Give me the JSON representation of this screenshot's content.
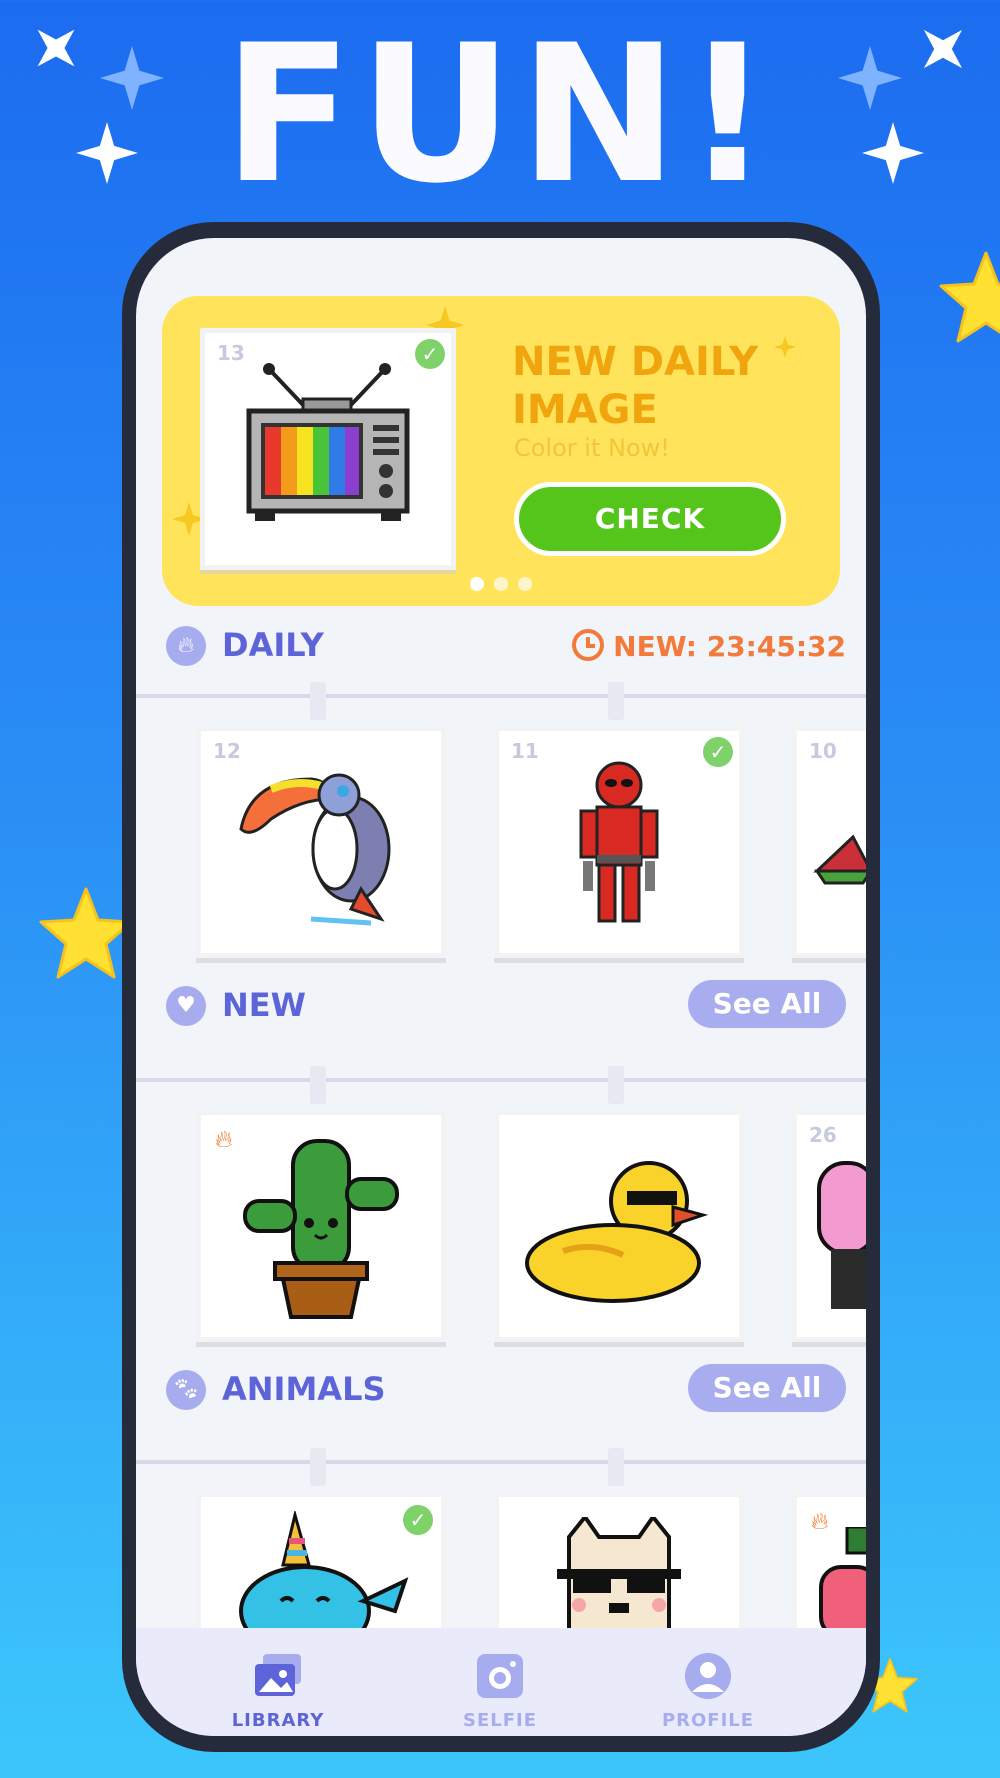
{
  "headline": "FUN!",
  "banner": {
    "card_number": "13",
    "title": "NEW DAILY IMAGE",
    "subtitle": "Color it Now!",
    "button": "CHECK",
    "page_count": 3,
    "active_page": 1
  },
  "daily": {
    "title": "DAILY",
    "timer": "NEW: 23:45:32",
    "cards": [
      {
        "number": "12",
        "name": "toucan",
        "completed": false
      },
      {
        "number": "11",
        "name": "red-hero",
        "completed": true
      },
      {
        "number": "10",
        "name": "watermelon",
        "completed": false
      }
    ]
  },
  "new": {
    "title": "NEW",
    "see_all": "See All",
    "cards": [
      {
        "number": "",
        "name": "cactus",
        "hot": true
      },
      {
        "number": "",
        "name": "duck",
        "hot": false
      },
      {
        "number": "26",
        "name": "ice-cream",
        "hot": false
      }
    ]
  },
  "animals": {
    "title": "ANIMALS",
    "see_all": "See All",
    "cards": [
      {
        "name": "narwhal-unicorn",
        "completed": true
      },
      {
        "name": "cool-cat",
        "completed": false
      },
      {
        "name": "strawberry",
        "hot": true
      }
    ]
  },
  "nav": {
    "library": "LIBRARY",
    "selfie": "SELFIE",
    "profile": "PROFILE",
    "active": "library"
  },
  "colors": {
    "accent": "#5d64d8",
    "banner": "#ffe35a",
    "check_button": "#55c51b",
    "timer": "#f27a3a"
  }
}
